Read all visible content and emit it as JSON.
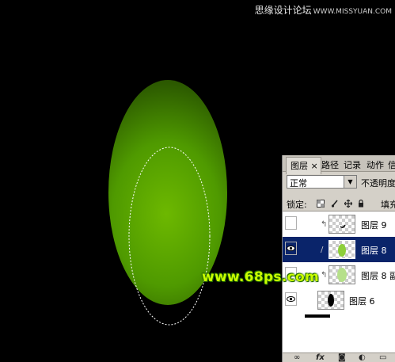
{
  "watermark_top": {
    "text": "思缘设计论坛",
    "site": "WWW.MISSYUAN.COM"
  },
  "watermark_bottom": {
    "text": "www.68ps.com"
  },
  "colors": {
    "egg_center": "#6db800",
    "egg_edge": "#1e3c00",
    "background": "#000000",
    "selected_layer": "#0a246a"
  },
  "layers_panel": {
    "tabs": [
      {
        "label": "图层",
        "active": true
      },
      {
        "label": "×"
      },
      {
        "label": "路径"
      },
      {
        "label": "记录"
      },
      {
        "label": "动作"
      },
      {
        "label": "信"
      }
    ],
    "blend_mode": "正常",
    "opacity_label": "不透明度",
    "lock_label": "锁定:",
    "fill_label": "填充",
    "layers": [
      {
        "name": "图层 9",
        "visible": false,
        "selected": false,
        "clipped": true
      },
      {
        "name": "图层 8",
        "visible": true,
        "selected": true,
        "clipped": false
      },
      {
        "name": "图层 8 副",
        "visible": false,
        "selected": false,
        "clipped": true
      },
      {
        "name": "图层 6",
        "visible": true,
        "selected": false,
        "clipped": false
      }
    ],
    "bottom_icons": [
      "link-icon",
      "fx-icon",
      "mask-icon",
      "adjustment-icon",
      "folder-icon"
    ]
  }
}
